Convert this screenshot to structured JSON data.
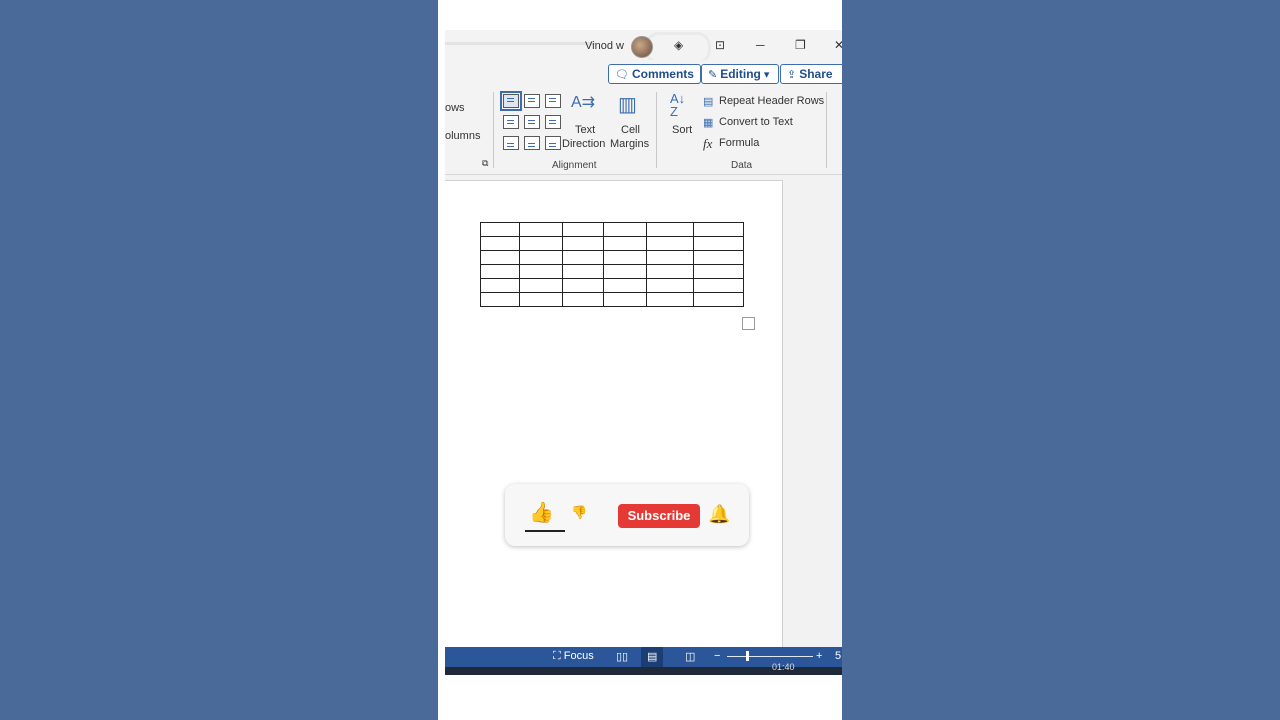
{
  "titlebar": {
    "user_name": "Vinod w",
    "icons": [
      "diamond-icon",
      "ribbon-display-icon",
      "minimize-icon",
      "restore-icon",
      "close-icon"
    ]
  },
  "commandbar": {
    "comments_label": "Comments",
    "editing_label": "Editing",
    "share_label": "Share"
  },
  "ribbon": {
    "partial_rows_label": "ows",
    "partial_columns_label": "olumns",
    "text_direction_label_1": "Text",
    "text_direction_label_2": "Direction",
    "cell_margins_label_1": "Cell",
    "cell_margins_label_2": "Margins",
    "alignment_group": "Alignment",
    "sort_label": "Sort",
    "repeat_header_rows": "Repeat Header Rows",
    "convert_to_text": "Convert to Text",
    "formula": "Formula",
    "data_group": "Data"
  },
  "document": {
    "table": {
      "rows": 6,
      "columns": 6
    }
  },
  "statusbar": {
    "focus_label": "Focus",
    "zoom_minus": "−",
    "zoom_plus": "+",
    "zoom_partial": "5",
    "time": "01:40"
  },
  "overlay": {
    "subscribe_label": "Subscribe"
  },
  "colors": {
    "accent": "#2b579a",
    "subscribe": "#e53935",
    "background": "#4a6a9a"
  }
}
